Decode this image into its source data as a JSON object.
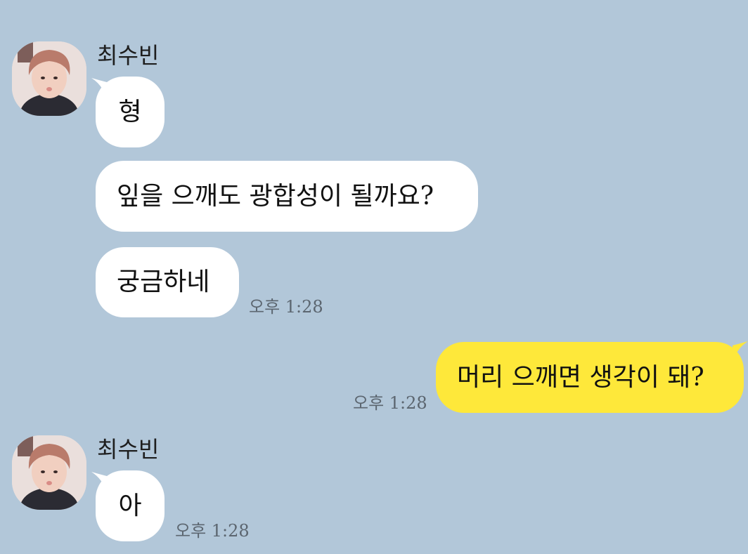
{
  "colors": {
    "background": "#b2c7d9",
    "incoming_bubble": "#ffffff",
    "outgoing_bubble": "#fee83a",
    "timestamp": "#5c6670"
  },
  "group1": {
    "sender": "최수빈",
    "avatar_icon": "profile-photo-icon",
    "messages": [
      "형",
      "잎을 으깨도 광합성이 될까요?",
      "궁금하네"
    ],
    "time": "오후 1:28"
  },
  "outgoing": {
    "message": "머리 으깨면 생각이 돼?",
    "time": "오후 1:28"
  },
  "group2": {
    "sender": "최수빈",
    "avatar_icon": "profile-photo-icon",
    "messages": [
      "아"
    ],
    "time": "오후 1:28"
  }
}
